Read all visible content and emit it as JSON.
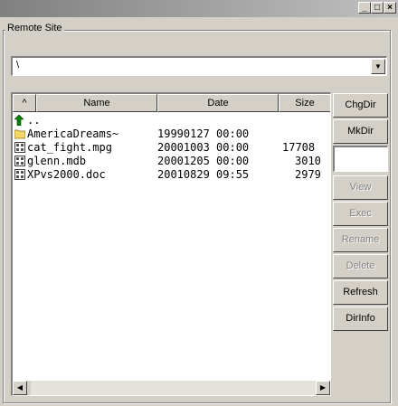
{
  "window": {
    "minimize_glyph": "_",
    "maximize_glyph": "□",
    "close_glyph": "×"
  },
  "group_title": "Remote Site",
  "path_combo": {
    "value": "\\",
    "arrow": "▼"
  },
  "columns": {
    "sort_arrow": "^",
    "name": "Name",
    "date": "Date",
    "size": "Size"
  },
  "files": [
    {
      "name": "..",
      "date": "",
      "size": "",
      "icon": "up-folder-icon"
    },
    {
      "name": "AmericaDreams~",
      "date": "19990127 00:00",
      "size": "",
      "icon": "folder-icon"
    },
    {
      "name": "cat_fight.mpg",
      "date": "20001003 00:00",
      "size": "17708",
      "icon": "binary-file-icon"
    },
    {
      "name": "glenn.mdb",
      "date": "20001205 00:00",
      "size": "3010",
      "icon": "binary-file-icon"
    },
    {
      "name": "XPvs2000.doc",
      "date": "20010829 09:55",
      "size": "2979",
      "icon": "binary-file-icon"
    }
  ],
  "scrollbar": {
    "left_arrow": "◀",
    "right_arrow": "▶"
  },
  "buttons": {
    "chgdir": "ChgDir",
    "mkdir": "MkDir",
    "view": "View",
    "exec": "Exec",
    "rename": "Rename",
    "delete": "Delete",
    "refresh": "Refresh",
    "dirinfo": "DirInfo"
  }
}
